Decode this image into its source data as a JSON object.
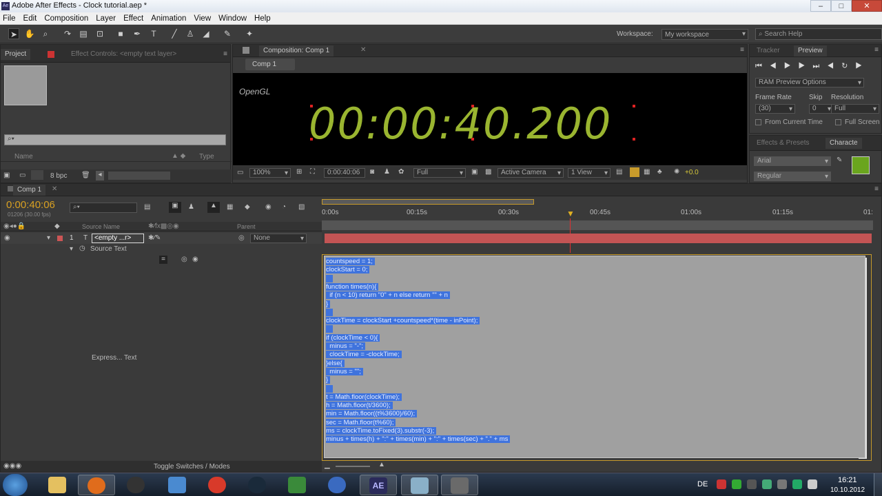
{
  "window": {
    "title": "Adobe After Effects - Clock tutorial.aep *",
    "app_icon": "Ae"
  },
  "menu": [
    "File",
    "Edit",
    "Composition",
    "Layer",
    "Effect",
    "Animation",
    "View",
    "Window",
    "Help"
  ],
  "workspace": {
    "label": "Workspace:",
    "value": "My workspace"
  },
  "search_help": {
    "placeholder": "Search Help"
  },
  "project_panel": {
    "tab_project": "Project",
    "tab_effect_controls": "Effect Controls: <empty text layer>",
    "col_name": "Name",
    "col_type": "Type",
    "bpc": "8 bpc"
  },
  "composition_panel": {
    "tab": "Composition: Comp 1",
    "breadcrumb": "Comp 1",
    "renderer": "OpenGL",
    "display_time": "00:00:40.200",
    "zoom": "100%",
    "current_time": "0:00:40:06",
    "resolution": "Full",
    "camera": "Active Camera",
    "views": "1 View",
    "exposure": "+0.0"
  },
  "preview_panel": {
    "tab_tracker": "Tracker",
    "tab_preview": "Preview",
    "ram_preview": "RAM Preview Options",
    "frame_rate_label": "Frame Rate",
    "skip_label": "Skip",
    "resolution_label": "Resolution",
    "frame_rate": "(30)",
    "skip": "0",
    "resolution": "Full",
    "from_current": "From Current Time",
    "full_screen": "Full Screen"
  },
  "character_panel": {
    "tab_effects": "Effects & Presets",
    "tab_character": "Characte",
    "font": "Arial",
    "style": "Regular",
    "color": "#6aa51e"
  },
  "timeline": {
    "tab": "Comp 1",
    "time": "0:00:40:06",
    "frames": "01206 (30.00 fps)",
    "col_source": "Source Name",
    "col_parent": "Parent",
    "layer_num": "1",
    "layer_name": "<empty ...r>",
    "parent_value": "None",
    "prop_name": "Source Text",
    "expr_label": "Express... Text",
    "ruler": [
      "0:00s",
      "00:15s",
      "00:30s",
      "00:45s",
      "01:00s",
      "01:15s",
      "01:"
    ],
    "bottom_label": "Toggle Switches / Modes"
  },
  "expression_lines": [
    "countspeed = 1;",
    "clockStart = 0;",
    "",
    "function times(n){",
    "  if (n < 10) return \"0\" + n else return \"\" + n",
    "}",
    "",
    "clockTime = clockStart +countspeed*(time - inPoint);",
    "",
    "if (clockTime < 0){",
    "  minus = \"-\";",
    "  clockTime = -clockTime;",
    "}else{",
    "  minus = \"\";",
    "}",
    "",
    "t = Math.floor(clockTime);",
    "h = Math.floor(t/3600);",
    "min = Math.floor((t%3600)/60);",
    "sec = Math.floor(t%60);",
    "ms = clockTime.toFixed(3).substr(-3);",
    "minus + times(h) + \":\" + times(min) + \":\" + times(sec) + \".\" + ms"
  ],
  "taskbar": {
    "lang": "DE",
    "time": "16:21",
    "date": "10.10.2012",
    "ae_label": "AE"
  }
}
